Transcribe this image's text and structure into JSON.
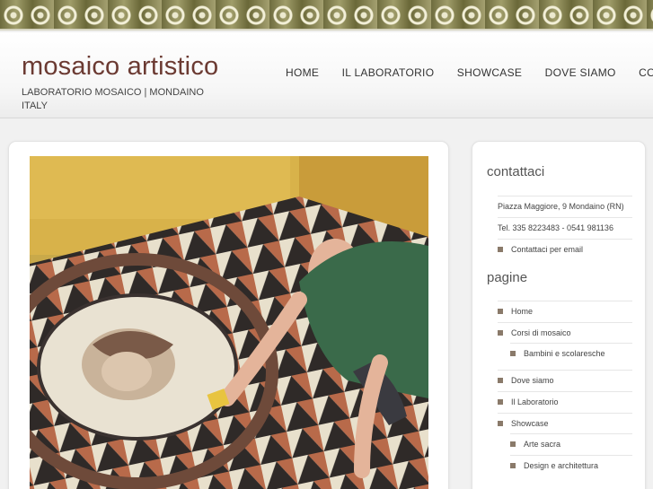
{
  "header": {
    "title": "mosaico artistico",
    "tagline": "LABORATORIO MOSAICO | MONDAINO ITALY"
  },
  "nav": {
    "items": [
      "HOME",
      "IL LABORATORIO",
      "SHOWCASE",
      "DOVE SIAMO",
      "CORSI"
    ]
  },
  "main": {
    "photo_alt": "mosaic artist working on floor mosaic"
  },
  "sidebar": {
    "contact": {
      "title": "contattaci",
      "address": "Piazza Maggiore, 9 Mondaino (RN)",
      "phone": "Tel. 335 8223483 - 0541 981136",
      "email_link": "Contattaci per email"
    },
    "pages": {
      "title": "pagine",
      "items": [
        {
          "label": "Home",
          "level": 0
        },
        {
          "label": "Corsi di mosaico",
          "level": 0
        },
        {
          "label": "Bambini e scolaresche",
          "level": 1
        },
        {
          "label": "Dove siamo",
          "level": 0
        },
        {
          "label": "Il Laboratorio",
          "level": 0
        },
        {
          "label": "Showcase",
          "level": 0
        },
        {
          "label": "Arte sacra",
          "level": 1
        },
        {
          "label": "Design e architettura",
          "level": 1
        }
      ]
    }
  },
  "colors": {
    "title": "#6b3a32",
    "bullet": "#8a7a6a"
  }
}
